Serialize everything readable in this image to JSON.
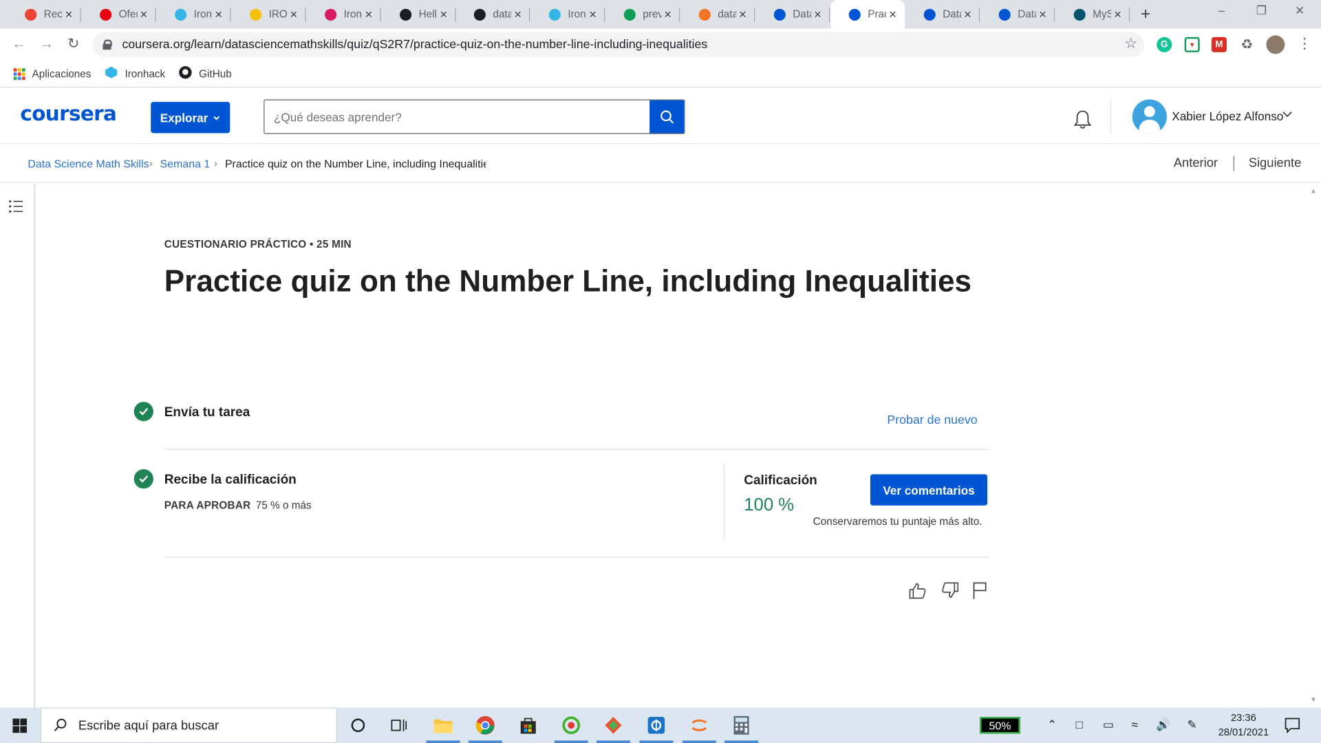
{
  "browser": {
    "tabs": [
      {
        "title": "Reci",
        "icon": "gmail-icon",
        "color": "#ea4335"
      },
      {
        "title": "Ofer",
        "icon": "uniqlo-icon",
        "color": "#e60012"
      },
      {
        "title": "Iron",
        "icon": "ironhack-icon",
        "color": "#33b5e5"
      },
      {
        "title": "IRON",
        "icon": "heart-icon",
        "color": "#f4c20d"
      },
      {
        "title": "Iron",
        "icon": "m-icon",
        "color": "#d81b60"
      },
      {
        "title": "Hell",
        "icon": "github-icon",
        "color": "#1b1f23"
      },
      {
        "title": "data",
        "icon": "github-icon",
        "color": "#1b1f23"
      },
      {
        "title": "Iron",
        "icon": "ironhack-icon",
        "color": "#33b5e5"
      },
      {
        "title": "prev",
        "icon": "sheets-icon",
        "color": "#0f9d58"
      },
      {
        "title": "data",
        "icon": "jupyter-icon",
        "color": "#f37626"
      },
      {
        "title": "Data",
        "icon": "coursera-icon",
        "color": "#0056d2"
      },
      {
        "title": "Prac",
        "icon": "coursera-icon",
        "color": "#0056d2",
        "active": true
      },
      {
        "title": "Data",
        "icon": "coursera-icon",
        "color": "#0056d2"
      },
      {
        "title": "Data",
        "icon": "coursera-icon",
        "color": "#0056d2"
      },
      {
        "title": "MyS",
        "icon": "mysql-icon",
        "color": "#00546b"
      }
    ],
    "url": "coursera.org/learn/datasciencemathskills/quiz/qS2R7/practice-quiz-on-the-number-line-including-inequalities",
    "bookmarks": [
      {
        "label": "Aplicaciones",
        "icon": "apps-grid-icon"
      },
      {
        "label": "Ironhack",
        "icon": "ironhack-icon"
      },
      {
        "label": "GitHub",
        "icon": "github-icon"
      }
    ]
  },
  "header": {
    "logo": "coursera",
    "explore_label": "Explorar",
    "search_placeholder": "¿Qué deseas aprender?",
    "user_name": "Xabier López Alfonso",
    "brand_color": "#0056d2"
  },
  "breadcrumb": {
    "course": "Data Science Math Skills",
    "week": "Semana 1",
    "current": "Practice quiz on the Number Line, including Inequalities",
    "prev_label": "Anterior",
    "next_label": "Siguiente"
  },
  "quiz": {
    "kicker": "CUESTIONARIO PRÁCTICO • 25 MIN",
    "title": "Practice quiz on the Number Line, including Inequalities",
    "step1_label": "Envía tu tarea",
    "retry_label": "Probar de nuevo",
    "step2_label": "Recibe la calificación",
    "pass_label": "PARA APROBAR",
    "pass_value": "75 % o más",
    "grade_label": "Calificación",
    "grade_value": "100 %",
    "feedback_label": "Ver comentarios",
    "keep_note": "Conservaremos tu puntaje más alto.",
    "success_color": "#1f8354"
  },
  "taskbar": {
    "search_placeholder": "Escribe aquí para buscar",
    "battery": "50%",
    "time": "23:36",
    "date": "28/01/2021"
  }
}
